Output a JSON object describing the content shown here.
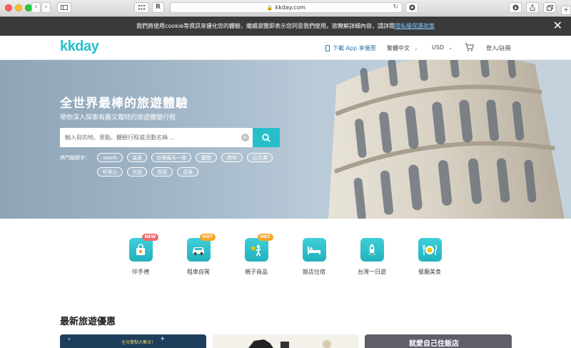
{
  "browser": {
    "url": "kkday.com"
  },
  "cookie_banner": {
    "text": "我們將使用cookie等資訊來優化您的體驗，繼續瀏覽即表示您同意我們使用。欲瞭解詳細內容，請詳閱",
    "link": "隱私權保護政策"
  },
  "header": {
    "logo": "kkday",
    "app_promo": "下載 App 享優惠",
    "language": "繁體中文",
    "currency": "USD",
    "login": "登入/註冊"
  },
  "hero": {
    "title": "全世界最棒的旅遊體驗",
    "subtitle": "帶你深入探索有趣又獨特的旅遊體驗行程",
    "search_placeholder": "輸入目的地、景點、體驗行程或活動名稱 ...",
    "hot_label": "熱門關鍵字：",
    "tags": [
      "xpark",
      "溫泉",
      "台灣兩天一夜",
      "露營",
      "跨年",
      "日月潭",
      "阿里山",
      "北投",
      "泡湯",
      "清境"
    ]
  },
  "categories": [
    {
      "label": "伴手禮",
      "badge": "NEW",
      "icon": "gift-bag-icon"
    },
    {
      "label": "租車自駕",
      "badge": "HOT",
      "icon": "car-icon"
    },
    {
      "label": "親子商品",
      "badge": "HOT",
      "icon": "kid-star-icon"
    },
    {
      "label": "飯店住宿",
      "badge": "",
      "icon": "bed-icon"
    },
    {
      "label": "台灣一日遊",
      "badge": "",
      "icon": "rocket-icon"
    },
    {
      "label": "餐廳美食",
      "badge": "",
      "icon": "dining-icon"
    }
  ],
  "deals": {
    "title": "最新旅遊優惠",
    "card1_text": "全台實點大集合！",
    "card3_text": "就愛自己住飯店"
  },
  "colors": {
    "brand": "#26bec9",
    "banner": "#3a3a3a"
  }
}
